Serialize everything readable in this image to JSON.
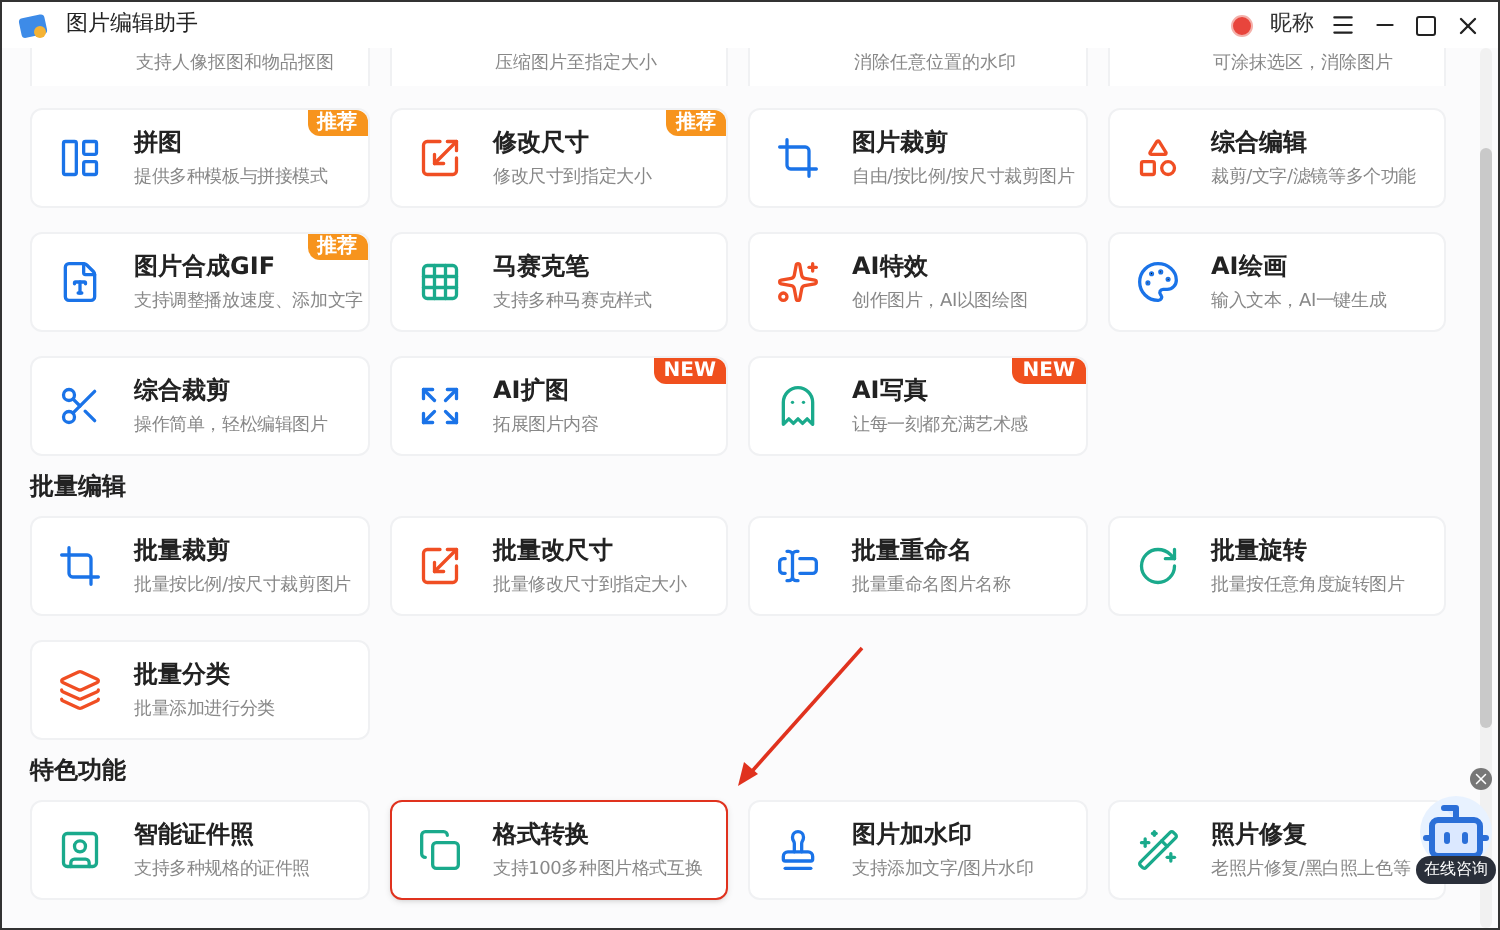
{
  "window": {
    "title": "图片编辑助手",
    "user_name": "昵称"
  },
  "top_cut_cards": [
    {
      "desc": "支持人像抠图和物品抠图"
    },
    {
      "desc": "压缩图片至指定大小"
    },
    {
      "desc": "消除任意位置的水印"
    },
    {
      "desc": "可涂抹选区，消除图片"
    }
  ],
  "sections": [
    {
      "cards": [
        {
          "title": "拼图",
          "desc": "提供多种模板与拼接模式",
          "badge": {
            "kind": "recommend",
            "text": "推荐"
          },
          "highlighted": false
        },
        {
          "title": "修改尺寸",
          "desc": "修改尺寸到指定大小",
          "badge": {
            "kind": "recommend",
            "text": "推荐"
          },
          "highlighted": false
        },
        {
          "title": "图片裁剪",
          "desc": "自由/按比例/按尺寸裁剪图片",
          "highlighted": false
        },
        {
          "title": "综合编辑",
          "desc": "裁剪/文字/滤镜等多个功能",
          "highlighted": false
        },
        {
          "title": "图片合成GIF",
          "desc": "支持调整播放速度、添加文字",
          "badge": {
            "kind": "recommend",
            "text": "推荐"
          },
          "highlighted": false
        },
        {
          "title": "马赛克笔",
          "desc": "支持多种马赛克样式",
          "highlighted": false
        },
        {
          "title": "AI特效",
          "desc": "创作图片，AI以图绘图",
          "highlighted": false
        },
        {
          "title": "AI绘画",
          "desc": "输入文本，AI一键生成",
          "highlighted": false
        },
        {
          "title": "综合裁剪",
          "desc": "操作简单，轻松编辑图片",
          "highlighted": false
        },
        {
          "title": "AI扩图",
          "desc": "拓展图片内容",
          "badge": {
            "kind": "new",
            "text": "NEW"
          },
          "highlighted": false
        },
        {
          "title": "AI写真",
          "desc": "让每一刻都充满艺术感",
          "badge": {
            "kind": "new",
            "text": "NEW"
          },
          "highlighted": false
        }
      ]
    },
    {
      "heading": "批量编辑",
      "cards": [
        {
          "title": "批量裁剪",
          "desc": "批量按比例/按尺寸裁剪图片",
          "highlighted": false
        },
        {
          "title": "批量改尺寸",
          "desc": "批量修改尺寸到指定大小",
          "highlighted": false
        },
        {
          "title": "批量重命名",
          "desc": "批量重命名图片名称",
          "highlighted": false
        },
        {
          "title": "批量旋转",
          "desc": "批量按任意角度旋转图片",
          "highlighted": false
        },
        {
          "title": "批量分类",
          "desc": "批量添加进行分类",
          "highlighted": false
        }
      ]
    },
    {
      "heading": "特色功能",
      "cards": [
        {
          "title": "智能证件照",
          "desc": "支持多种规格的证件照",
          "highlighted": false
        },
        {
          "title": "格式转换",
          "desc": "支持100多种图片格式互换",
          "highlighted": true
        },
        {
          "title": "图片加水印",
          "desc": "支持添加文字/图片水印",
          "highlighted": false
        },
        {
          "title": "照片修复",
          "desc": "老照片修复/黑白照上色等",
          "highlighted": false
        }
      ]
    }
  ],
  "chat_widget": {
    "label": "在线咨询"
  }
}
